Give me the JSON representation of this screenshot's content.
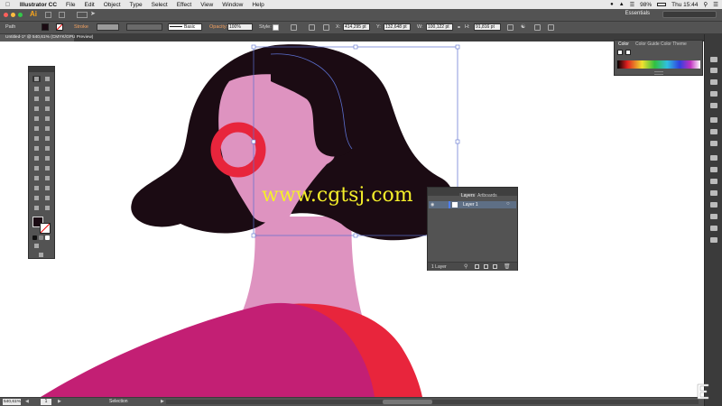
{
  "menubar": {
    "app": "Illustrator CC",
    "items": [
      "File",
      "Edit",
      "Object",
      "Type",
      "Select",
      "Effect",
      "View",
      "Window",
      "Help"
    ],
    "battery": "98%",
    "clock": "Thu 15:44"
  },
  "appbar": {
    "logo": "Ai",
    "workspace": "Essentials"
  },
  "control": {
    "selection": "Path",
    "stroke_label": "Stroke",
    "brush": "Basic",
    "opacity_label": "Opacity:",
    "opacity": "100%",
    "style_label": "Style:",
    "x": "414,295 pt",
    "y": "132,648 pt",
    "w": "100,122 pt",
    "h": "91,816 pt"
  },
  "document": {
    "tab": "Untitled-1* @ 540,61% (CMYK/GPU Preview)"
  },
  "color_panel": {
    "tabs": [
      "Color",
      "Color Guide",
      "Color Theme"
    ]
  },
  "layers_panel": {
    "tabs": [
      "Layers",
      "Artboards"
    ],
    "layer_name": "Layer 1",
    "count": "1 Layer"
  },
  "status": {
    "zoom": "540,61%",
    "page": "1",
    "tool": "Selection"
  },
  "watermark": "www.cgtsj.com",
  "colors": {
    "hair": "#1b0b13",
    "skin": "#de93c0",
    "earring": "#e8253c",
    "dress": "#c31f74",
    "dress_shadow": "#e8253c",
    "selection": "#5b6fcf",
    "ui_panel": "#535353"
  },
  "icons": {
    "apple": "apple-icon",
    "wifi": "wifi-icon",
    "search": "spotlight-icon",
    "lock": "lock-icon"
  }
}
